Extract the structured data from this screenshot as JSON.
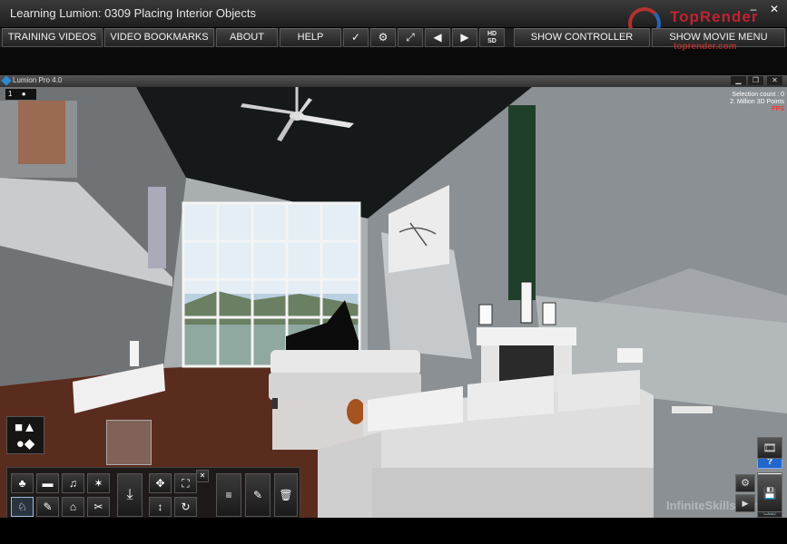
{
  "app": {
    "title": "Learning Lumion: 0309 Placing Interior Objects",
    "window_buttons": {
      "minimize": "–",
      "close": "✕"
    },
    "watermark": {
      "main": "TopRender",
      "sub": "toprender.com"
    }
  },
  "menu": {
    "training_videos": "TRAINING VIDEOS",
    "video_bookmarks": "VIDEO BOOKMARKS",
    "about": "ABOUT",
    "help": "HELP",
    "check": "✓",
    "settings": "⚙",
    "fullscreen": "⤢",
    "prev": "◀",
    "next": "▶",
    "hd_top": "HD",
    "hd_bottom": "SD",
    "show_controller": "SHOW CONTROLLER",
    "show_movie_menu": "SHOW MOVIE MENU"
  },
  "lumion": {
    "window_title": "Lumion Pro 4.0",
    "buttons": {
      "minimize": "▁",
      "restore": "❐",
      "close": "✕"
    },
    "hud": {
      "layer_number": "1",
      "selection_count": "Selection count : 0",
      "points": "2. Million 3D Points",
      "fps": "FPS"
    },
    "object_tools": {
      "nature": "♣",
      "transport": "▬",
      "sound": "♫",
      "effects": "✶",
      "indoor": "♘",
      "people": "✎",
      "buildings": "⌂",
      "utilities": "✂",
      "place": "⤓",
      "move": "✥",
      "resize": "⛶",
      "close_x": "✕",
      "height": "↕",
      "rotate": "↻",
      "properties": "≡",
      "edit": "✎",
      "delete": "🗑"
    },
    "shapes_button": "■▲ ●◆",
    "modes": {
      "help": "?",
      "build": "⛏",
      "photo": "📷",
      "movie": "🎞",
      "settings": "⚙",
      "save": "💾",
      "play": "▶"
    },
    "brand_watermark": "InfiniteSkills.com"
  },
  "colors": {
    "accent_blue": "#2266cc",
    "hud_red": "#ff3333"
  }
}
